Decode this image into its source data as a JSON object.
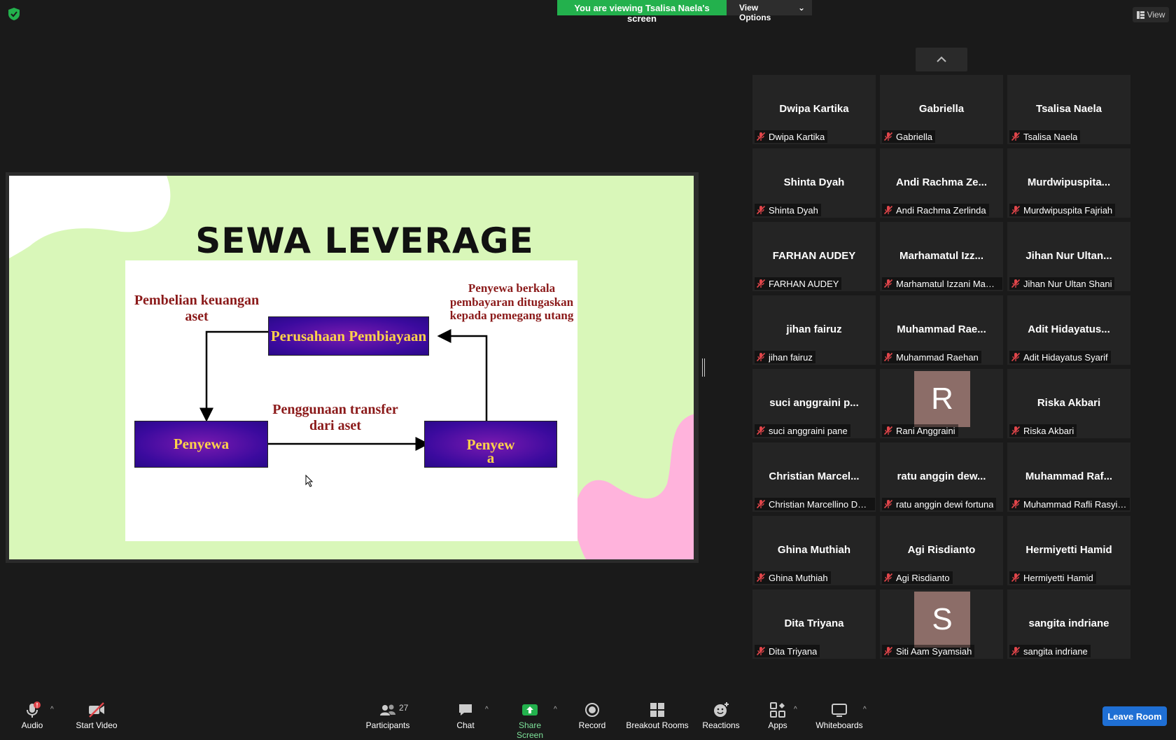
{
  "top": {
    "viewing_text": "You are viewing Tsalisa Naela's screen",
    "view_options_label": "View Options",
    "view_label": "View"
  },
  "slide": {
    "title": "SEWA LEVERAGE",
    "label_left": "Pembelian keuangan aset",
    "label_right": "Penyewa berkala pembayaran ditugaskan kepada pemegang utang",
    "label_middle": "Penggunaan transfer dari aset",
    "box_top": "Perusahaan Pembiayaan",
    "box_left": "Penyewa",
    "box_right_line1": "Penyew",
    "box_right_line2": "a"
  },
  "participants": [
    {
      "name": "Dwipa Kartika",
      "label": "Dwipa Kartika"
    },
    {
      "name": "Gabriella",
      "label": "Gabriella"
    },
    {
      "name": "Tsalisa Naela",
      "label": "Tsalisa Naela"
    },
    {
      "name": "Shinta Dyah",
      "label": "Shinta Dyah"
    },
    {
      "name": "Andi Rachma Ze...",
      "label": "Andi Rachma Zerlinda"
    },
    {
      "name": "Murdwipuspita...",
      "label": "Murdwipuspita Fajriah"
    },
    {
      "name": "FARHAN AUDEY",
      "label": "FARHAN AUDEY"
    },
    {
      "name": "Marhamatul Izz...",
      "label": "Marhamatul Izzani Mauli..."
    },
    {
      "name": "Jihan Nur Ultan...",
      "label": "Jihan Nur Ultan Shani"
    },
    {
      "name": "jihan fairuz",
      "label": "jihan fairuz"
    },
    {
      "name": "Muhammad Rae...",
      "label": "Muhammad Raehan"
    },
    {
      "name": "Adit Hidayatus...",
      "label": "Adit Hidayatus Syarif"
    },
    {
      "name": "suci anggraini p...",
      "label": "suci anggraini pane"
    },
    {
      "name": "",
      "avatar": "R",
      "label": "Rani Anggraini"
    },
    {
      "name": "Riska Akbari",
      "label": "Riska Akbari"
    },
    {
      "name": "Christian Marcel...",
      "label": "Christian Marcellino Dwi..."
    },
    {
      "name": "ratu anggin dew...",
      "label": "ratu anggin dewi fortuna"
    },
    {
      "name": "Muhammad Raf...",
      "label": "Muhammad Rafli Rasyidin"
    },
    {
      "name": "Ghina Muthiah",
      "label": "Ghina Muthiah"
    },
    {
      "name": "Agi Risdianto",
      "label": "Agi Risdianto"
    },
    {
      "name": "Hermiyetti Hamid",
      "label": "Hermiyetti Hamid"
    },
    {
      "name": "Dita Triyana",
      "label": "Dita Triyana"
    },
    {
      "name": "",
      "avatar": "S",
      "label": "Siti Aam Syamsiah"
    },
    {
      "name": "sangita indriane",
      "label": "sangita indriane"
    }
  ],
  "toolbar": {
    "audio": "Audio",
    "start_video": "Start Video",
    "participants": "Participants",
    "participants_count": "27",
    "chat": "Chat",
    "share_screen": "Share Screen",
    "record": "Record",
    "breakout_rooms": "Breakout Rooms",
    "reactions": "Reactions",
    "apps": "Apps",
    "whiteboards": "Whiteboards",
    "leave": "Leave Room"
  },
  "colors": {
    "share_green": "#23b14d",
    "leave_blue": "#1f6fd4",
    "slide_bg": "#d9f7b9",
    "label_red": "#8b1a1a",
    "box_purple": "#4a0ea8",
    "box_text": "#ffd24a",
    "mute_red": "#e0454a"
  }
}
